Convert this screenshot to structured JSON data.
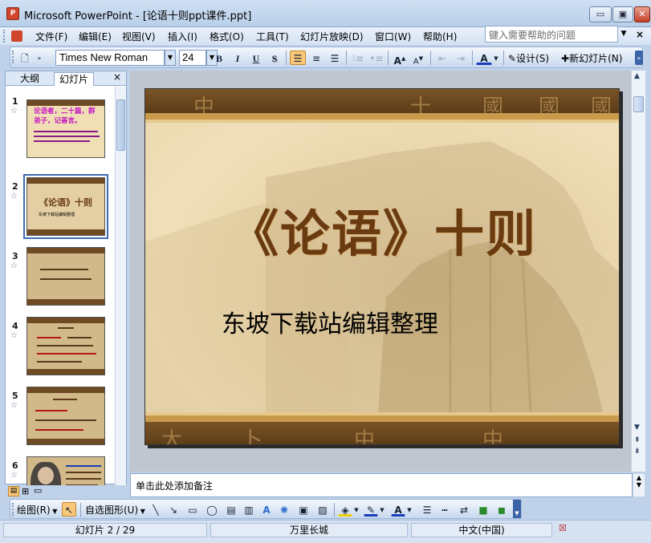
{
  "window": {
    "title": "Microsoft PowerPoint - [论语十则ppt课件.ppt]",
    "app_icon_label": "P",
    "minimize": "▭",
    "maximize": "▣",
    "close": "✕"
  },
  "menu": {
    "items": [
      "文件(F)",
      "编辑(E)",
      "视图(V)",
      "插入(I)",
      "格式(O)",
      "工具(T)",
      "幻灯片放映(D)",
      "窗口(W)",
      "帮助(H)"
    ],
    "help_placeholder": "键入需要帮助的问题",
    "doc_close": "×"
  },
  "toolbar": {
    "font_name": "Times New Roman",
    "font_size": "24",
    "bold": "B",
    "italic": "I",
    "underline": "U",
    "shadow": "S",
    "design_label": "设计(S)",
    "new_slide_label": "新幻灯片(N)"
  },
  "left_pane": {
    "tab_outline": "大纲",
    "tab_slides": "幻灯片",
    "close": "×",
    "thumbnails": [
      {
        "num": "1",
        "title": "论语者，二十篇，群弟子，记善言。"
      },
      {
        "num": "2",
        "title": "《论语》十则",
        "sub": "东坡下载站编辑整理"
      },
      {
        "num": "3"
      },
      {
        "num": "4"
      },
      {
        "num": "5"
      },
      {
        "num": "6"
      }
    ]
  },
  "slide": {
    "title": "《论语》十则",
    "subtitle": "东坡下载站编辑整理",
    "band_glyphs_top": [
      "中",
      "十",
      "國",
      "國",
      "國"
    ],
    "band_glyphs_bottom": [
      "大",
      "卜",
      "中",
      "中"
    ]
  },
  "notes": {
    "placeholder": "单击此处添加备注"
  },
  "drawing_toolbar": {
    "draw_label": "绘图(R)",
    "autoshapes_label": "自选图形(U)"
  },
  "status": {
    "slide_info": "幻灯片 2 / 29",
    "design_name": "万里长城",
    "language": "中文(中国)"
  },
  "colors": {
    "title_brown": "#6a3a10",
    "band_brown": "#5b3b18",
    "office_blue": "#bfd2ea"
  }
}
